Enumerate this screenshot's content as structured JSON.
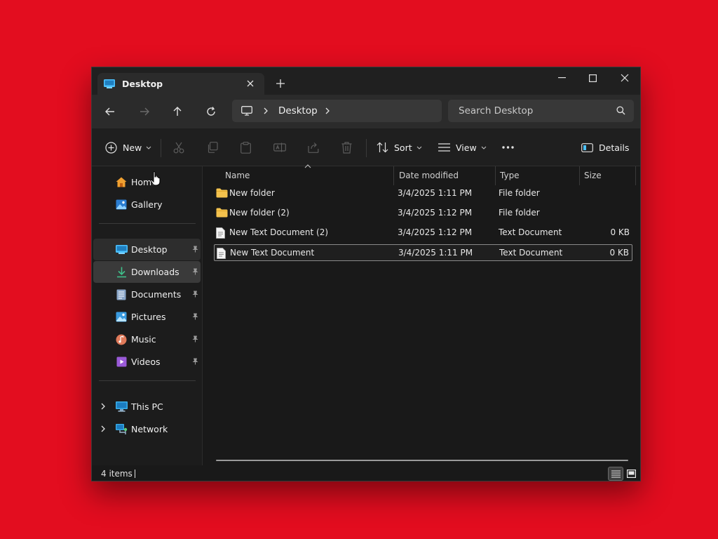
{
  "window": {
    "tab_title": "Desktop"
  },
  "address": {
    "crumb": "Desktop",
    "search_placeholder": "Search Desktop"
  },
  "toolbar": {
    "new_label": "New",
    "sort_label": "Sort",
    "view_label": "View",
    "details_label": "Details"
  },
  "sidebar": {
    "quick": [
      {
        "label": "Home",
        "icon": "home-icon"
      },
      {
        "label": "Gallery",
        "icon": "gallery-icon"
      }
    ],
    "pinned": [
      {
        "label": "Desktop",
        "icon": "desktop-folder-icon"
      },
      {
        "label": "Downloads",
        "icon": "downloads-icon"
      },
      {
        "label": "Documents",
        "icon": "documents-icon"
      },
      {
        "label": "Pictures",
        "icon": "pictures-icon"
      },
      {
        "label": "Music",
        "icon": "music-icon"
      },
      {
        "label": "Videos",
        "icon": "videos-icon"
      }
    ],
    "devices": [
      {
        "label": "This PC",
        "icon": "this-pc-icon"
      },
      {
        "label": "Network",
        "icon": "network-icon"
      }
    ]
  },
  "columns": {
    "name": "Name",
    "date": "Date modified",
    "type": "Type",
    "size": "Size"
  },
  "files": [
    {
      "name": "New folder",
      "date": "3/4/2025 1:11 PM",
      "type": "File folder",
      "size": "",
      "icon": "folder-icon"
    },
    {
      "name": "New folder (2)",
      "date": "3/4/2025 1:12 PM",
      "type": "File folder",
      "size": "",
      "icon": "folder-icon"
    },
    {
      "name": "New Text Document (2)",
      "date": "3/4/2025 1:12 PM",
      "type": "Text Document",
      "size": "0 KB",
      "icon": "text-file-icon"
    },
    {
      "name": "New Text Document",
      "date": "3/4/2025 1:11 PM",
      "type": "Text Document",
      "size": "0 KB",
      "icon": "text-file-icon"
    }
  ],
  "status": {
    "item_count": "4 items"
  },
  "colors": {
    "background": "#e30d1f",
    "folder": "#f4c24d",
    "accent": "#4cc2ff"
  }
}
